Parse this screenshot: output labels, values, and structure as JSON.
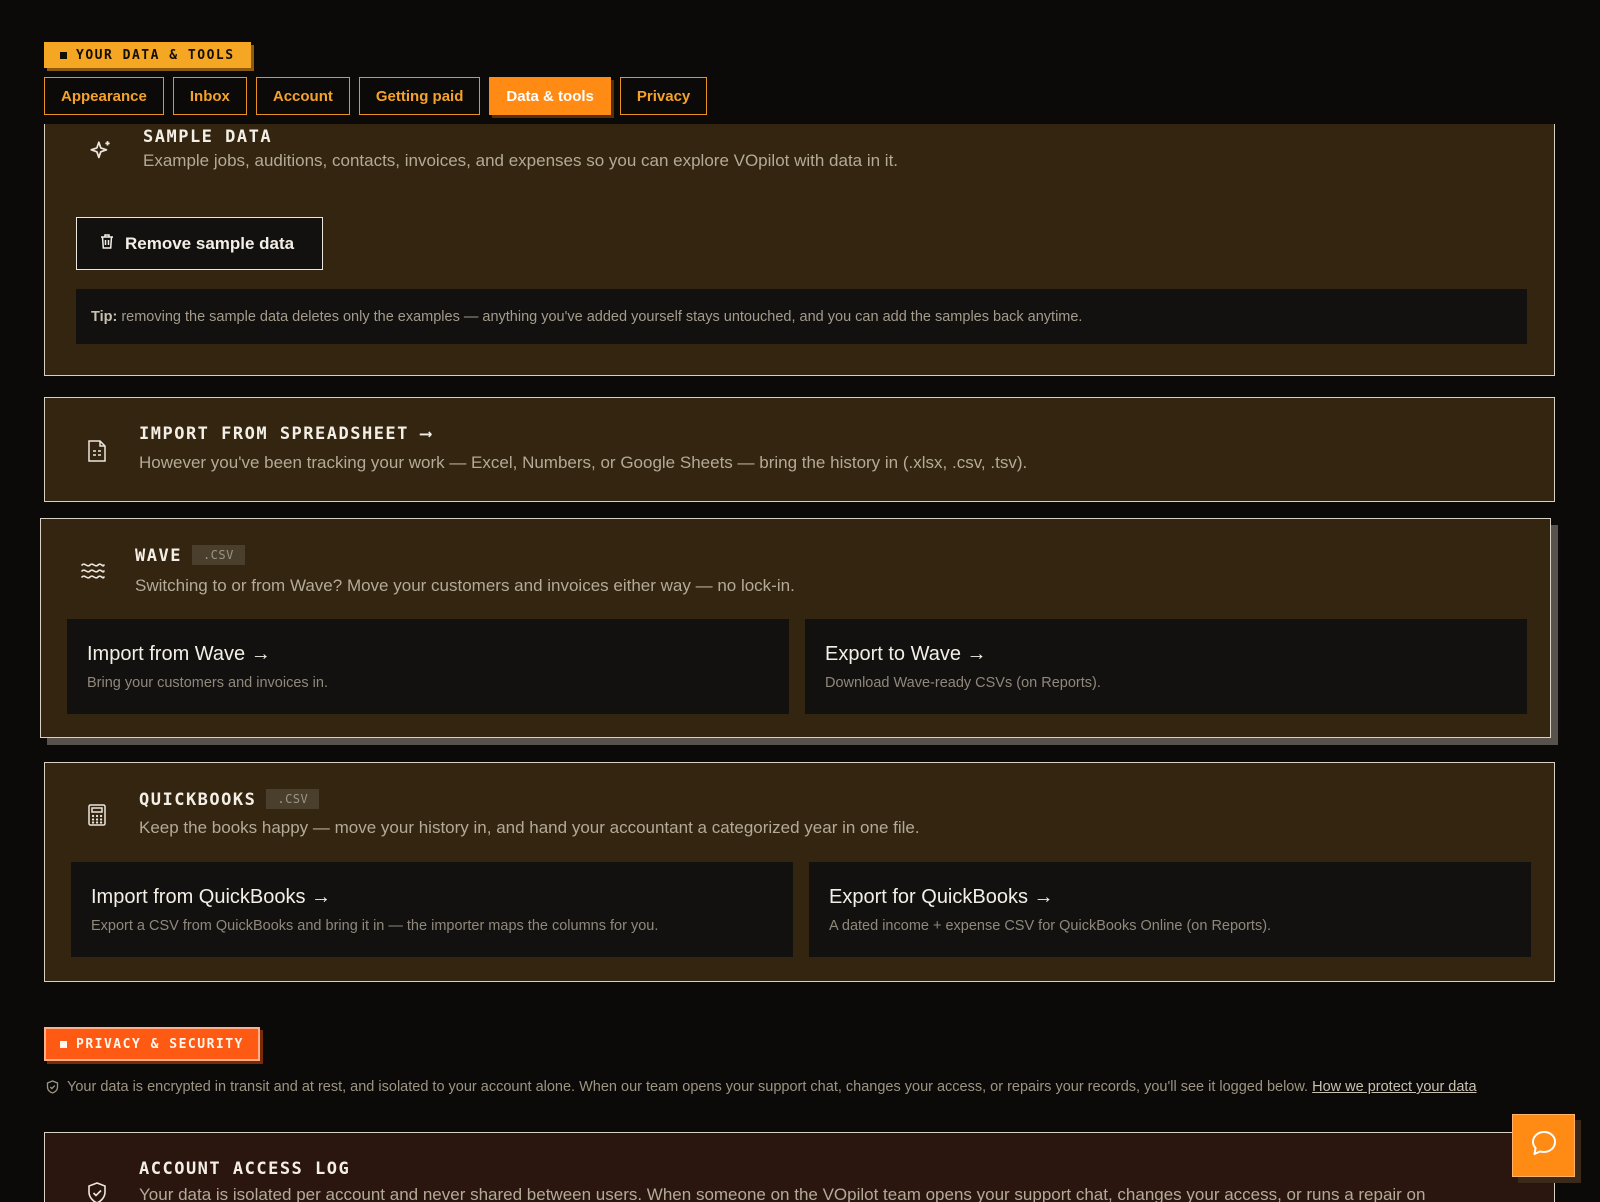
{
  "header": {
    "section_tag": "YOUR DATA & TOOLS",
    "tabs": [
      {
        "label": "Appearance"
      },
      {
        "label": "Inbox"
      },
      {
        "label": "Account"
      },
      {
        "label": "Getting paid"
      },
      {
        "label": "Data & tools",
        "active": true
      },
      {
        "label": "Privacy"
      }
    ]
  },
  "sample": {
    "title": "SAMPLE DATA",
    "description": "Example jobs, auditions, contacts, invoices, and expenses so you can explore VOpilot with data in it.",
    "remove_button": "Remove sample data",
    "tip_label": "Tip:",
    "tip_text": "removing the sample data deletes only the examples — anything you've added yourself stays untouched, and you can add the samples back anytime."
  },
  "import_spreadsheet": {
    "title": "IMPORT FROM SPREADSHEET ⟶",
    "description": "However you've been tracking your work — Excel, Numbers, or Google Sheets — bring the history in (.xlsx, .csv, .tsv)."
  },
  "wave": {
    "title": "WAVE",
    "badge": ".CSV",
    "description": "Switching to or from Wave? Move your customers and invoices either way — no lock-in.",
    "import": {
      "title": "Import from Wave →",
      "subtitle": "Bring your customers and invoices in."
    },
    "export": {
      "title": "Export to Wave →",
      "subtitle": "Download Wave-ready CSVs (on Reports)."
    }
  },
  "quickbooks": {
    "title": "QUICKBOOKS",
    "badge": ".CSV",
    "description": "Keep the books happy — move your history in, and hand your accountant a categorized year in one file.",
    "import": {
      "title": "Import from QuickBooks →",
      "subtitle": "Export a CSV from QuickBooks and bring it in — the importer maps the columns for you."
    },
    "export": {
      "title": "Export for QuickBooks →",
      "subtitle": "A dated income + expense CSV for QuickBooks Online (on Reports)."
    }
  },
  "privacy": {
    "section_tag": "PRIVACY & SECURITY",
    "note": "Your data is encrypted in transit and at rest, and isolated to your account alone. When our team opens your support chat, changes your access, or repairs your records, you'll see it logged below. ",
    "link": "How we protect your data"
  },
  "access_log": {
    "title": "ACCOUNT ACCESS LOG",
    "description": "Your data is isolated per account and never shared between users. When someone on the VOpilot team opens your support chat, changes your access, or runs a repair on"
  },
  "colors": {
    "accent": "#ff8a14",
    "amber": "#f5a622",
    "alert": "#ff5a14",
    "card_bg": "#33250f"
  },
  "icons": [
    "sparkle-icon",
    "trash-icon",
    "spreadsheet-icon",
    "waves-icon",
    "calculator-icon",
    "shield-icon",
    "chat-bubble-icon"
  ]
}
